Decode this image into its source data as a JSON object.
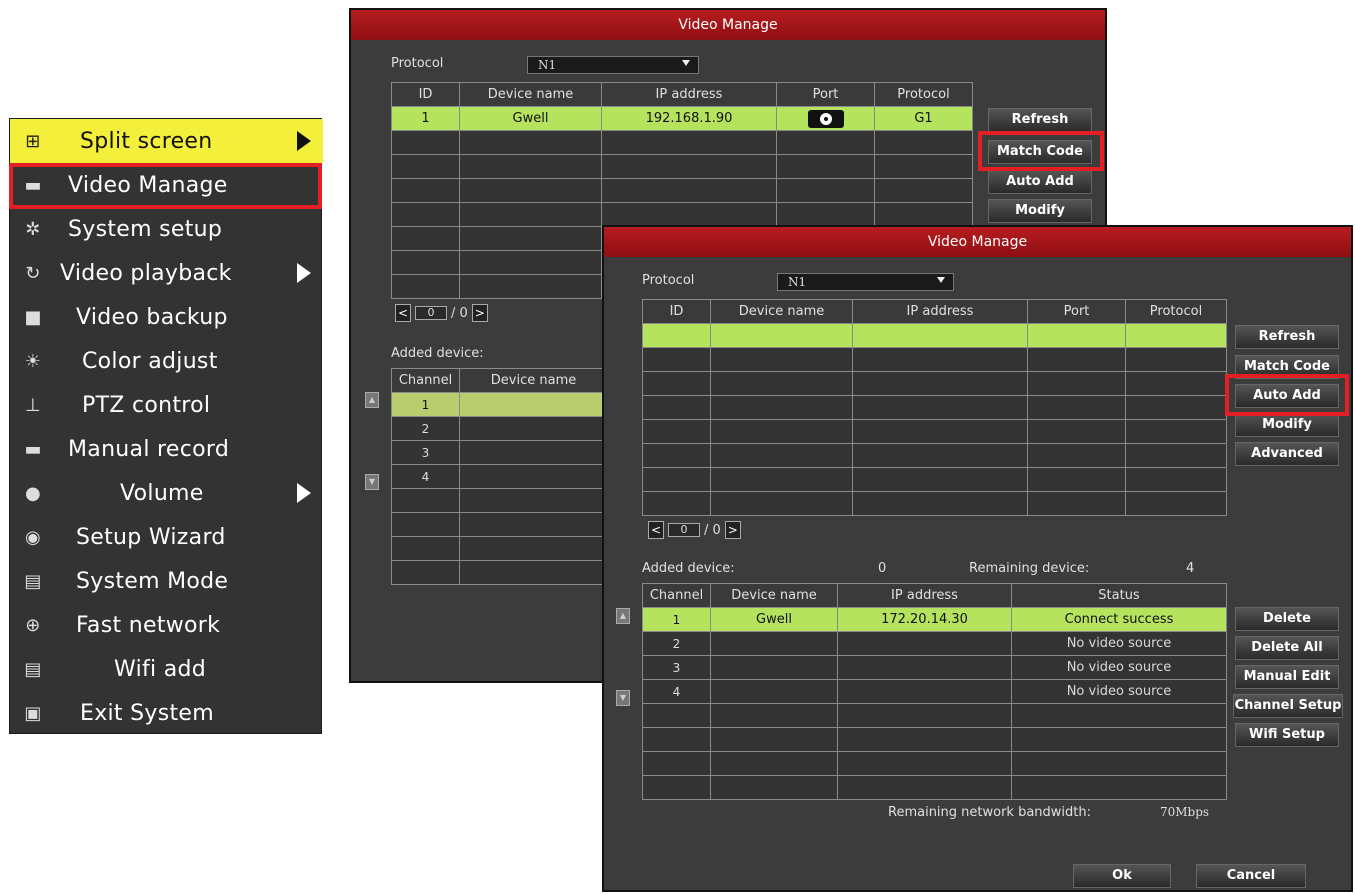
{
  "menu": {
    "items": [
      {
        "label": "Split screen",
        "icon": "split-screen-icon",
        "arrow": true
      },
      {
        "label": "Video Manage",
        "icon": "camera-icon",
        "arrow": false
      },
      {
        "label": "System setup",
        "icon": "gear-icon",
        "arrow": false
      },
      {
        "label": "Video playback",
        "icon": "playback-icon",
        "arrow": true
      },
      {
        "label": "Video backup",
        "icon": "backup-icon",
        "arrow": false
      },
      {
        "label": "Color adjust",
        "icon": "brightness-icon",
        "arrow": false
      },
      {
        "label": "PTZ control",
        "icon": "ptz-icon",
        "arrow": false
      },
      {
        "label": "Manual record",
        "icon": "record-icon",
        "arrow": false
      },
      {
        "label": "Volume",
        "icon": "volume-icon",
        "arrow": true
      },
      {
        "label": "Setup Wizard",
        "icon": "wizard-icon",
        "arrow": false
      },
      {
        "label": "System Mode",
        "icon": "document-gear-icon",
        "arrow": false
      },
      {
        "label": "Fast network",
        "icon": "globe-icon",
        "arrow": false
      },
      {
        "label": "Wifi add",
        "icon": "document-gear-icon",
        "arrow": false
      },
      {
        "label": "Exit System",
        "icon": "exit-icon",
        "arrow": false
      }
    ]
  },
  "dialog1": {
    "title": "Video Manage",
    "protocol_label": "Protocol",
    "protocol_value": "N1",
    "search_headers": [
      "ID",
      "Device name",
      "IP address",
      "Port",
      "Protocol"
    ],
    "search_row": {
      "id": "1",
      "name": "Gwell",
      "ip": "192.168.1.90",
      "protocol": "G1"
    },
    "buttons": {
      "refresh": "Refresh",
      "match_code": "Match Code",
      "auto_add": "Auto Add",
      "modify": "Modify"
    },
    "pager": {
      "page": "0",
      "total": "/ 0"
    },
    "added_label": "Added device:",
    "added_headers": [
      "Channel",
      "Device name"
    ],
    "channels": [
      "1",
      "2",
      "3",
      "4"
    ]
  },
  "dialog2": {
    "title": "Video Manage",
    "protocol_label": "Protocol",
    "protocol_value": "N1",
    "search_headers": [
      "ID",
      "Device name",
      "IP address",
      "Port",
      "Protocol"
    ],
    "buttons": {
      "refresh": "Refresh",
      "match_code": "Match Code",
      "auto_add": "Auto Add",
      "modify": "Modify",
      "advanced": "Advanced"
    },
    "pager": {
      "page": "0",
      "total": "/ 0"
    },
    "added_label": "Added device:",
    "added_count": "0",
    "remaining_label": "Remaining device:",
    "remaining_count": "4",
    "added_headers": [
      "Channel",
      "Device name",
      "IP address",
      "Status"
    ],
    "added_rows": [
      {
        "channel": "1",
        "name": "Gwell",
        "ip": "172.20.14.30",
        "status": "Connect success"
      },
      {
        "channel": "2",
        "name": "",
        "ip": "",
        "status": "No video source"
      },
      {
        "channel": "3",
        "name": "",
        "ip": "",
        "status": "No video source"
      },
      {
        "channel": "4",
        "name": "",
        "ip": "",
        "status": "No video source"
      }
    ],
    "side_buttons": {
      "delete": "Delete",
      "delete_all": "Delete All",
      "manual_edit": "Manual Edit",
      "channel_setup": "Channel Setup",
      "wifi_setup": "Wifi Setup"
    },
    "bandwidth_label": "Remaining network bandwidth:",
    "bandwidth_value": "70Mbps",
    "ok": "Ok",
    "cancel": "Cancel"
  },
  "colors": {
    "highlight_red": "#e41e25",
    "menu_active": "#f4ef3a",
    "row_selected": "#b5e35e",
    "title_bar": "#b71c20"
  }
}
